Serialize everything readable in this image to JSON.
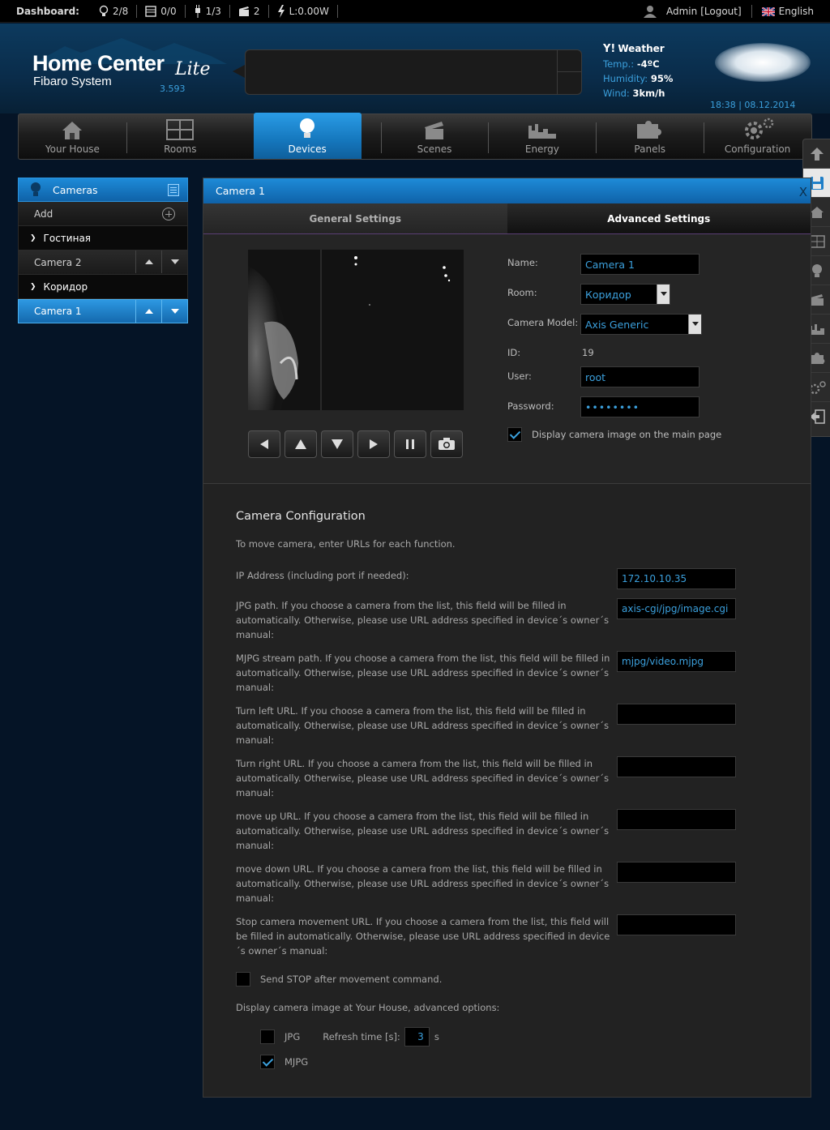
{
  "dashboard": {
    "label": "Dashboard:",
    "lights": "2/8",
    "blinds": "0/0",
    "plugs": "1/3",
    "scenes": "2",
    "power": "L:0.00W"
  },
  "user": {
    "name": "Admin",
    "logout": "[Logout]",
    "language": "English"
  },
  "header": {
    "title": "Home Center",
    "edition": "Lite",
    "subtitle": "Fibaro System",
    "version": "3.593",
    "weather": {
      "title": "Weather",
      "temp_label": "Temp.:",
      "temp_value": "-4ºC",
      "humidity_label": "Humidity:",
      "humidity_value": "95%",
      "wind_label": "Wind:",
      "wind_value": "3km/h"
    },
    "datetime": "18:38 | 08.12.2014"
  },
  "nav": [
    {
      "label": "Your House",
      "icon": "house-icon"
    },
    {
      "label": "Rooms",
      "icon": "rooms-icon"
    },
    {
      "label": "Devices",
      "icon": "bulb-icon"
    },
    {
      "label": "Scenes",
      "icon": "clapper-icon"
    },
    {
      "label": "Energy",
      "icon": "chart-icon"
    },
    {
      "label": "Panels",
      "icon": "puzzle-icon"
    },
    {
      "label": "Configuration",
      "icon": "gear-icon"
    }
  ],
  "sidebar": {
    "title": "Cameras",
    "add": "Add",
    "rooms": [
      {
        "name": "Гостиная",
        "devices": [
          "Camera 2"
        ]
      },
      {
        "name": "Коридор",
        "devices": [
          "Camera 1"
        ]
      }
    ]
  },
  "panel": {
    "title": "Camera 1",
    "close": "X",
    "tabs": {
      "general": "General Settings",
      "advanced": "Advanced Settings"
    },
    "form": {
      "name_label": "Name:",
      "name_value": "Camera 1",
      "room_label": "Room:",
      "room_value": "Коридор",
      "model_label": "Camera Model:",
      "model_value": "Axis Generic",
      "id_label": "ID:",
      "id_value": "19",
      "user_label": "User:",
      "user_value": "root",
      "password_label": "Password:",
      "password_value": "••••••••",
      "display_main": "Display camera image on the main page"
    },
    "config": {
      "title": "Camera Configuration",
      "intro": "To move camera, enter URLs for each function.",
      "ip_label": "IP Address (including port if needed):",
      "ip_value": "172.10.10.35",
      "jpg_label": "JPG path. If you choose a camera from the list, this field will be filled in automatically. Otherwise, please use URL address specified in device´s owner´s manual:",
      "jpg_value": "axis-cgi/jpg/image.cgi",
      "mjpg_label": "MJPG stream path. If you choose a camera from the list, this field will be filled in automatically. Otherwise, please use URL address specified in device´s owner´s manual:",
      "mjpg_value": "mjpg/video.mjpg",
      "left_label": "Turn left URL. If you choose a camera from the list, this field will be filled in automatically. Otherwise, please use URL address specified in device´s owner´s manual:",
      "right_label": "Turn right URL. If you choose a camera from the list, this field will be filled in automatically. Otherwise, please use URL address specified in device´s owner´s manual:",
      "up_label": "move up URL. If you choose a camera from the list, this field will be filled in automatically. Otherwise, please use URL address specified in device´s owner´s manual:",
      "down_label": "move down URL. If you choose a camera from the list, this field will be filled in automatically. Otherwise, please use URL address specified in device´s owner´s manual:",
      "stop_label": "Stop camera movement URL. If you choose a camera from the list, this field will be filled in automatically. Otherwise, please use URL address specified in device´s owner´s manual:",
      "send_stop": "Send STOP after movement command.",
      "display_options": "Display camera image at Your House, advanced options:",
      "jpg_option": "JPG",
      "refresh_label": "Refresh time [s]:",
      "refresh_value": "3",
      "refresh_unit": "s",
      "mjpg_option": "MJPG"
    }
  },
  "colors": {
    "accent": "#3ba0dd",
    "active_tab": "#1e8bd8"
  }
}
